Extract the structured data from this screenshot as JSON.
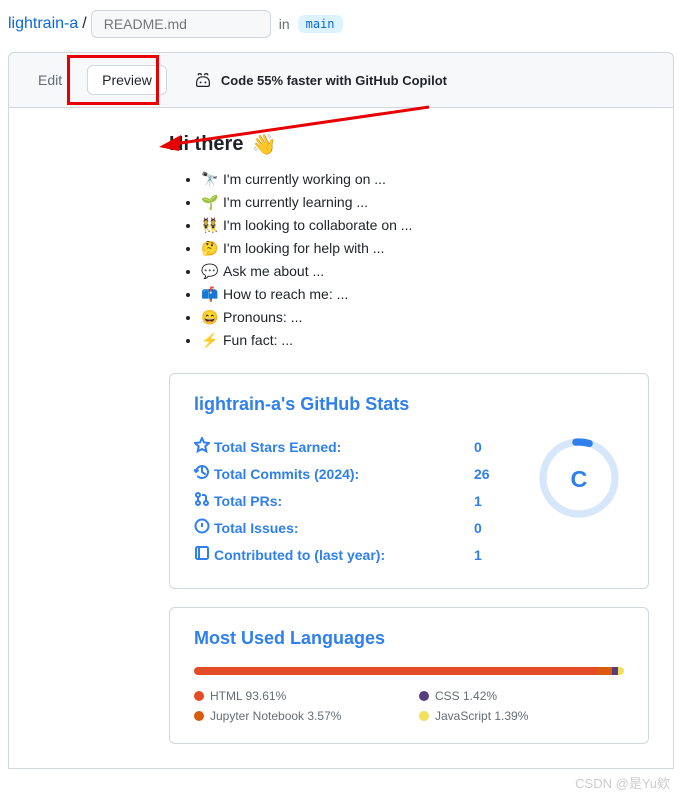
{
  "breadcrumb": {
    "repo": "lightrain-a",
    "file_placeholder": "README.md",
    "in": "in",
    "branch": "main"
  },
  "toolbar": {
    "edit": "Edit",
    "preview": "Preview",
    "copilot": "Code 55% faster with GitHub Copilot"
  },
  "readme": {
    "heading": "Hi there",
    "items": [
      {
        "emoji": "🔭",
        "text": "I'm currently working on ..."
      },
      {
        "emoji": "🌱",
        "text": "I'm currently learning ..."
      },
      {
        "emoji": "👯",
        "text": "I'm looking to collaborate on ..."
      },
      {
        "emoji": "🤔",
        "text": "I'm looking for help with ..."
      },
      {
        "emoji": "💬",
        "text": "Ask me about ..."
      },
      {
        "emoji": "📫",
        "text": "How to reach me: ..."
      },
      {
        "emoji": "😄",
        "text": "Pronouns: ..."
      },
      {
        "emoji": "⚡",
        "text": "Fun fact: ..."
      }
    ]
  },
  "stats": {
    "title": "lightrain-a's GitHub Stats",
    "rows": [
      {
        "icon": "star",
        "label": "Total Stars Earned:",
        "val": "0"
      },
      {
        "icon": "history",
        "label": "Total Commits (2024):",
        "val": "26"
      },
      {
        "icon": "pr",
        "label": "Total PRs:",
        "val": "1"
      },
      {
        "icon": "issue",
        "label": "Total Issues:",
        "val": "0"
      },
      {
        "icon": "repo",
        "label": "Contributed to (last year):",
        "val": "1"
      }
    ],
    "rank": "C"
  },
  "langs": {
    "title": "Most Used Languages",
    "items": [
      {
        "name": "HTML",
        "pct": "93.61%",
        "color": "#e34c26"
      },
      {
        "name": "CSS",
        "pct": "1.42%",
        "color": "#563d7c"
      },
      {
        "name": "Jupyter Notebook",
        "pct": "3.57%",
        "color": "#DA5B0B"
      },
      {
        "name": "JavaScript",
        "pct": "1.39%",
        "color": "#f1e05a"
      }
    ]
  },
  "watermark": "CSDN @是Yu欸"
}
